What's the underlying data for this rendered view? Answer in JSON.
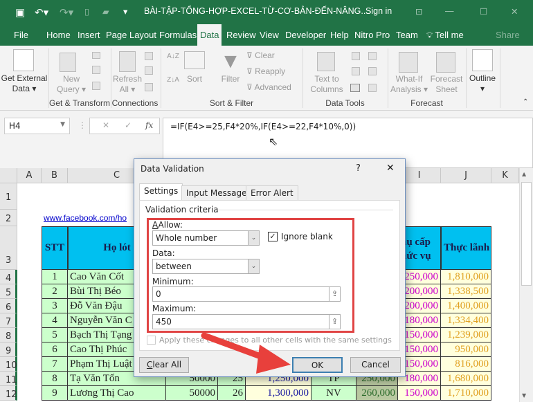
{
  "window": {
    "title": "BÀI-TẬP-TỔNG-HỢP-EXCEL-TỪ-CƠ-BẢN-ĐẾN-NÂNG...",
    "sign_in": "Sign in"
  },
  "menu_tabs": [
    "File",
    "Home",
    "Insert",
    "Page Layout",
    "Formulas",
    "Data",
    "Review",
    "View",
    "Developer",
    "Help",
    "Nitro Pro",
    "Team",
    "Tell me"
  ],
  "share": "Share",
  "ribbon": {
    "get_external": "Get External",
    "get_external2": "Data ▾",
    "new_query": "New",
    "new_query2": "Query ▾",
    "refresh": "Refresh",
    "refresh2": "All ▾",
    "sort": "Sort",
    "filter": "Filter",
    "clear": "Clear",
    "reapply": "Reapply",
    "advanced": "Advanced",
    "text_to": "Text to",
    "columns": "Columns",
    "what_if": "What-If",
    "analysis": "Analysis ▾",
    "forecast": "Forecast",
    "sheet": "Sheet",
    "outline": "Outline",
    "groups": [
      "Get & Transform",
      "Connections",
      "Sort & Filter",
      "Data Tools",
      "Forecast"
    ]
  },
  "formula_bar": {
    "name_box": "H4",
    "fx": "fx",
    "formula": "=IF(E4>=25,F4*20%,IF(E4>=22,F4*10%,0))"
  },
  "sheet": {
    "columns": [
      "A",
      "B",
      "C",
      "I",
      "J",
      "K"
    ],
    "row_numbers": [
      "1",
      "2",
      "3",
      "4",
      "5",
      "6",
      "7",
      "8",
      "9",
      "10",
      "11",
      "12"
    ],
    "link": "www.facebook.com/ho",
    "headers": {
      "stt": "STT",
      "ho_lot": "Họ lót",
      "phu_cap": "hụ cấp",
      "phu_cap2": "hức vụ",
      "thuc_lanh": "Thực lãnh"
    },
    "rows": [
      {
        "stt": "1",
        "name": "Cao Văn Cốt",
        "pc": "250,000",
        "tl": "1,810,000"
      },
      {
        "stt": "2",
        "name": "Bùi Thị Béo",
        "pc": "200,000",
        "tl": "1,338,500"
      },
      {
        "stt": "3",
        "name": "Đỗ Văn Đậu",
        "pc": "200,000",
        "tl": "1,400,000"
      },
      {
        "stt": "4",
        "name": "Nguyễn Văn C",
        "pc": "180,000",
        "tl": "1,334,400"
      },
      {
        "stt": "5",
        "name": "Bạch Thị Tạng",
        "pc": "150,000",
        "tl": "1,239,000"
      },
      {
        "stt": "6",
        "name": "Cao Thị Phúc",
        "pc": "150,000",
        "tl": "950,000"
      },
      {
        "stt": "7",
        "name": "Phạm Thị Luật",
        "pc": "150,000",
        "tl": "816,000"
      },
      {
        "stt": "8",
        "name": "Tạ Văn Tốn",
        "luong": "50000",
        "ngay": "25",
        "tien": "1,250,000",
        "cv": "TP",
        "h": "250,000",
        "pc": "180,000",
        "tl": "1,680,000"
      },
      {
        "stt": "9",
        "name": "Lương Thị Cao",
        "luong": "50000",
        "ngay": "26",
        "tien": "1,300,000",
        "cv": "NV",
        "h": "260,000",
        "pc": "150,000",
        "tl": "1,710,000"
      }
    ]
  },
  "dialog": {
    "title": "Data Validation",
    "help": "?",
    "close": "✕",
    "tabs": [
      "Settings",
      "Input Message",
      "Error Alert"
    ],
    "section": "Validation criteria",
    "allow_label": "Allow:",
    "allow_value": "Whole number",
    "ignore_blank": "Ignore blank",
    "ignore_blank_checked": true,
    "data_label": "Data:",
    "data_value": "between",
    "min_label": "Minimum:",
    "min_value": "0",
    "max_label": "Maximum:",
    "max_value": "450",
    "apply_all": "Apply these changes to all other cells with the same settings",
    "clear_all": "Clear All",
    "ok": "OK",
    "cancel": "Cancel"
  },
  "colors": {
    "excel_green": "#217346",
    "header_fill": "#00c0f0",
    "row_fill": "#ccffcc",
    "yellow_fill": "#ffffcc",
    "highlight": "#e04444",
    "magenta": "#cc00cc",
    "orange": "#e0a020"
  }
}
